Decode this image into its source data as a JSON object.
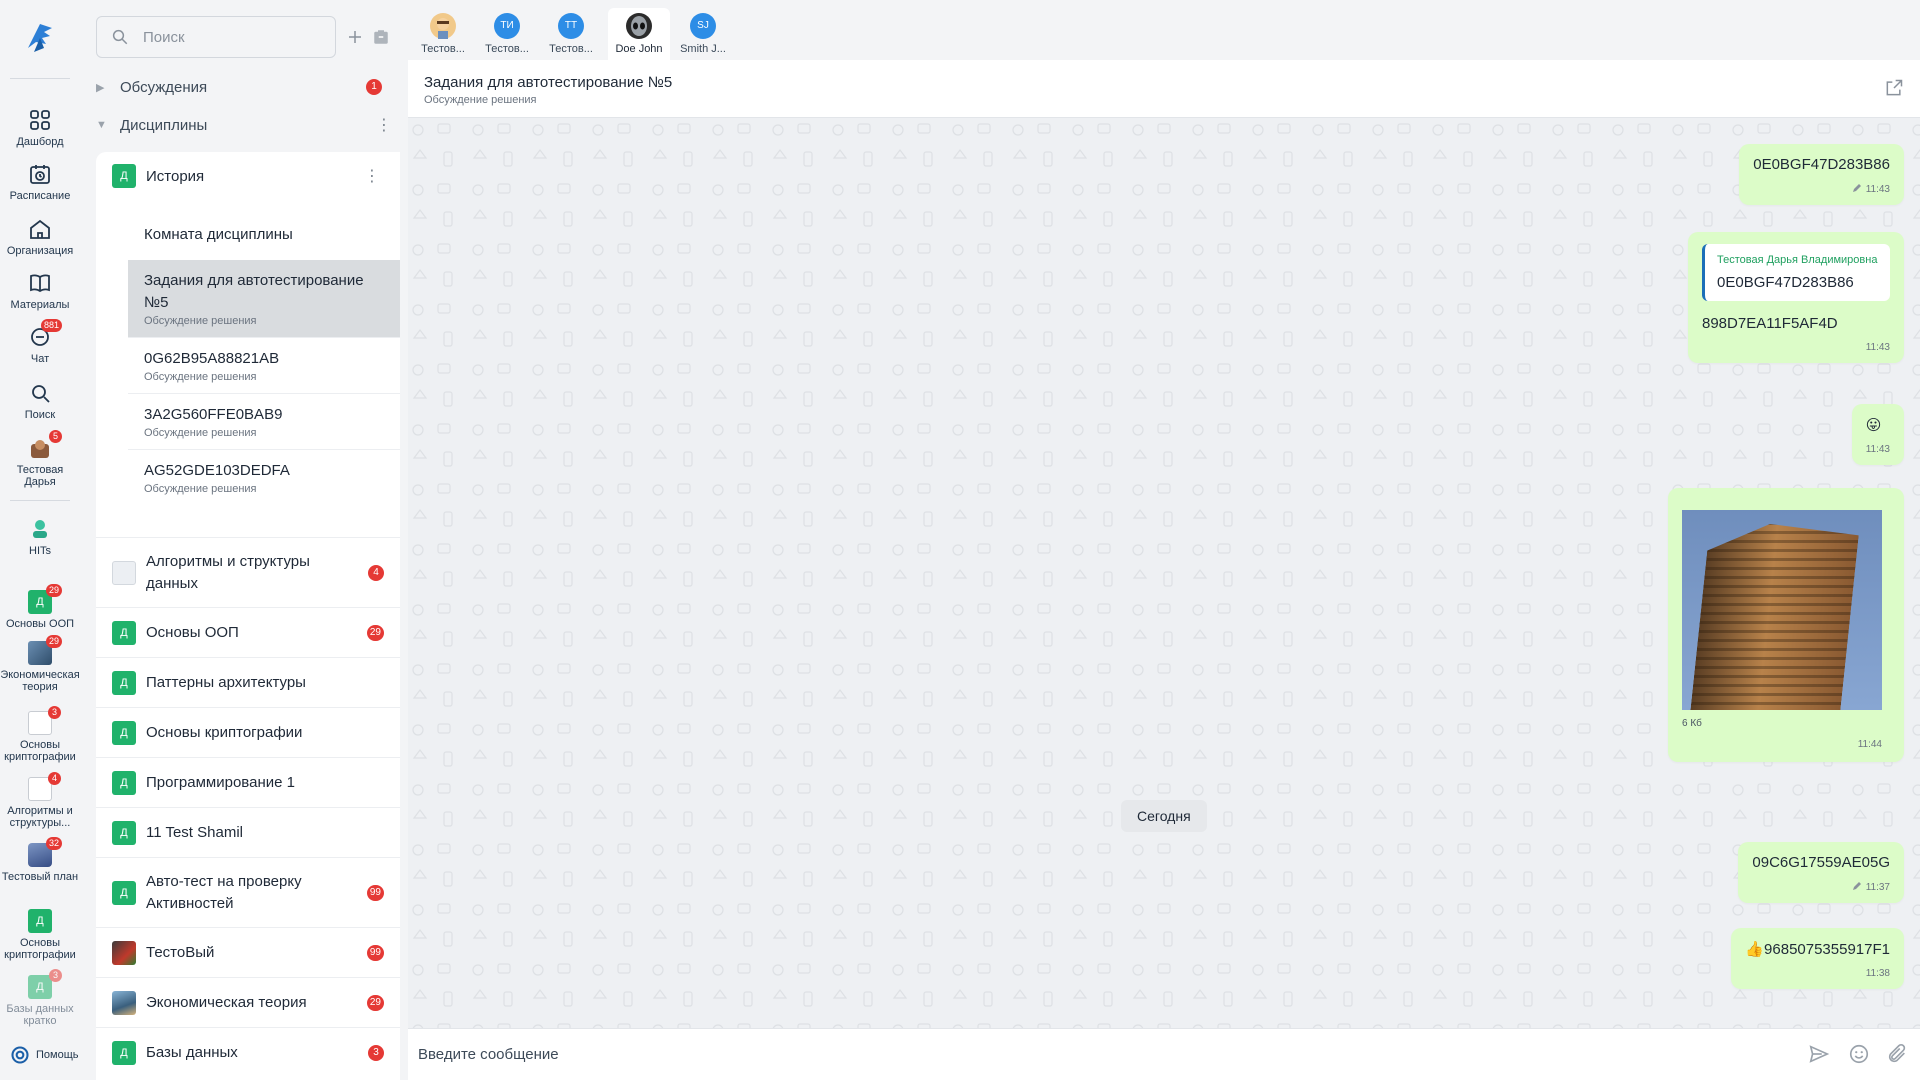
{
  "rail": {
    "items": [
      {
        "label": "Дашборд",
        "icon": "dashboard-icon"
      },
      {
        "label": "Расписание",
        "icon": "calendar-icon"
      },
      {
        "label": "Организация",
        "icon": "home-icon"
      },
      {
        "label": "Материалы",
        "icon": "book-icon"
      },
      {
        "label": "Чат",
        "icon": "chat-icon",
        "badge": "881"
      },
      {
        "label": "Поиск",
        "icon": "search-icon"
      },
      {
        "label": "Тестовая Дарья",
        "icon": "avatar",
        "badge": "5"
      },
      {
        "label": "HITs",
        "icon": "hits-icon"
      }
    ],
    "courses": [
      {
        "label": "Основы ООП",
        "badge": "29",
        "kind": "d"
      },
      {
        "label": "Экономическая теория",
        "badge": "29",
        "kind": "img"
      },
      {
        "label": "Основы криптографии",
        "badge": "3",
        "kind": "doc"
      },
      {
        "label": "Алгоритмы и структуры...",
        "badge": "4",
        "kind": "doc"
      },
      {
        "label": "Тестовый план",
        "badge": "32",
        "kind": "phone"
      },
      {
        "label": "Основы криптографии",
        "badge": "",
        "kind": "d"
      },
      {
        "label": "Базы данных кратко",
        "badge": "3",
        "kind": "d"
      }
    ],
    "help_label": "Помощь"
  },
  "sidebar": {
    "search_placeholder": "Поиск",
    "sections": [
      {
        "label": "Обсуждения",
        "count": "1"
      },
      {
        "label": "Дисциплины"
      }
    ],
    "open_course": {
      "badge": "Д",
      "title": "История",
      "room": "Комната дисциплины",
      "items": [
        {
          "title": "Задания для автотестирование №5",
          "subtitle": "Обсуждение решения",
          "active": true
        },
        {
          "title": "0G62B95A88821AB",
          "subtitle": "Обсуждение решения"
        },
        {
          "title": "3A2G560FFE0BAB9",
          "subtitle": "Обсуждение решения"
        },
        {
          "title": "AG52GDE103DEDFA",
          "subtitle": "Обсуждение решения"
        }
      ]
    },
    "courses": [
      {
        "title": "Алгоритмы и структуры данных",
        "count": "4",
        "icon": "robot"
      },
      {
        "title": "Основы ООП",
        "count": "29",
        "icon": "d"
      },
      {
        "title": "Паттерны архитектуры",
        "count": "",
        "icon": "d"
      },
      {
        "title": "Основы криптографии",
        "count": "",
        "icon": "d"
      },
      {
        "title": "Программирование 1",
        "count": "",
        "icon": "d"
      },
      {
        "title": "11 Test Shamil",
        "count": "",
        "icon": "d"
      },
      {
        "title": "Авто-тест на проверку Активностей",
        "count": "99",
        "icon": "d"
      },
      {
        "title": "ТестоВый",
        "count": "99",
        "icon": "mario"
      },
      {
        "title": "Экономическая теория",
        "count": "29",
        "icon": "eco"
      },
      {
        "title": "Базы данных",
        "count": "3",
        "icon": "d"
      }
    ],
    "badge_letter": "Д"
  },
  "tabs": [
    {
      "name": "Тестов...",
      "avatar": "face",
      "initials": ""
    },
    {
      "name": "Тестов...",
      "avatar": "blue",
      "initials": "ТИ"
    },
    {
      "name": "Тестов...",
      "avatar": "blue",
      "initials": "ТТ"
    },
    {
      "name": "Doe John",
      "avatar": "alien",
      "initials": "",
      "active": true
    },
    {
      "name": "Smith J...",
      "avatar": "blue",
      "initials": "SJ"
    }
  ],
  "chat": {
    "title": "Задания для автотестирование №5",
    "subtitle": "Обсуждение решения",
    "messages": [
      {
        "text": "0E0BGF47D283B86",
        "time": "11:43",
        "edited": true
      },
      {
        "quote_author": "Тестовая Дарья Владимировна",
        "quote_text": "0E0BGF47D283B86",
        "text": "898D7EA11F5AF4D",
        "time": "11:43"
      },
      {
        "text": "😛",
        "time": "11:43"
      },
      {
        "file_size": "6 Кб",
        "time": "11:44"
      },
      {
        "text": "09C6G17559AE05G",
        "time": "11:37",
        "edited": true
      },
      {
        "text": "👍9685075355917F1",
        "time": "11:38"
      }
    ],
    "day_separator": "Сегодня",
    "composer_placeholder": "Введите сообщение"
  },
  "colors": {
    "accent": "#20b26b",
    "bubble": "#dcfcc8",
    "badge": "#e53935",
    "quote_bar": "#1b6fb8"
  }
}
